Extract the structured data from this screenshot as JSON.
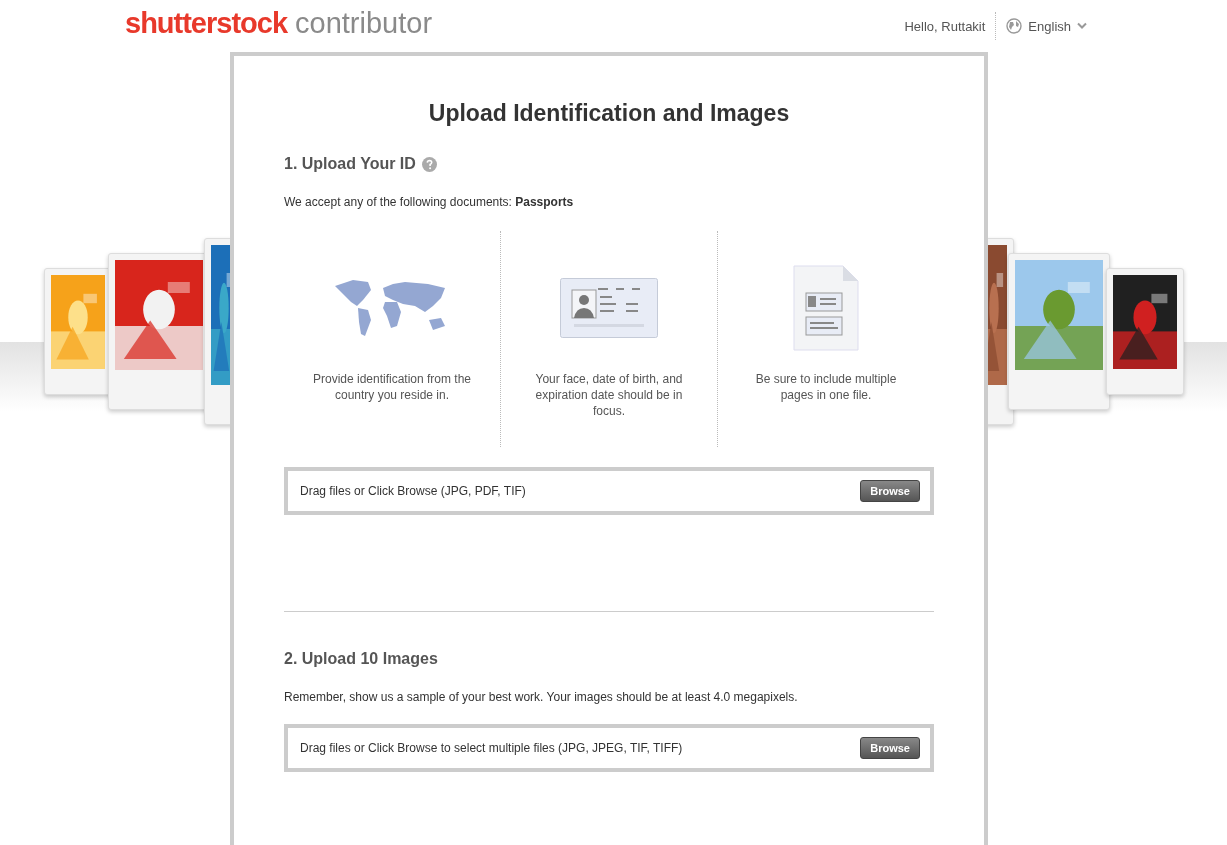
{
  "header": {
    "brand": "shutterstock",
    "product": "contributor",
    "greeting": "Hello, Ruttakit",
    "language": "English"
  },
  "title": "Upload Identification and Images",
  "sections": [
    {
      "heading": "1. Upload Your ID",
      "help": true,
      "text": "We accept any of the following documents: **Passports**",
      "tips": [
        {
          "kind": "map",
          "text": "Provide identification from the country you reside in."
        },
        {
          "kind": "card",
          "text": "Your face, date of birth, and expiration date should be in focus."
        },
        {
          "kind": "document",
          "text": "Be sure to include multiple pages in one file."
        }
      ],
      "dropzone": {
        "text": "Drag files or Click Browse (JPG, PDF, TIF)",
        "button": "Browse"
      }
    },
    {
      "heading": "2. Upload 10 Images",
      "help": false,
      "text": "Remember, show us a sample of your best work. Your images should be at least 4.0 megapixels.",
      "dropzone": {
        "text": "Drag files or Click Browse to select multiple files (JPG, JPEG, TIF, TIFF)",
        "button": "Browse"
      }
    }
  ]
}
